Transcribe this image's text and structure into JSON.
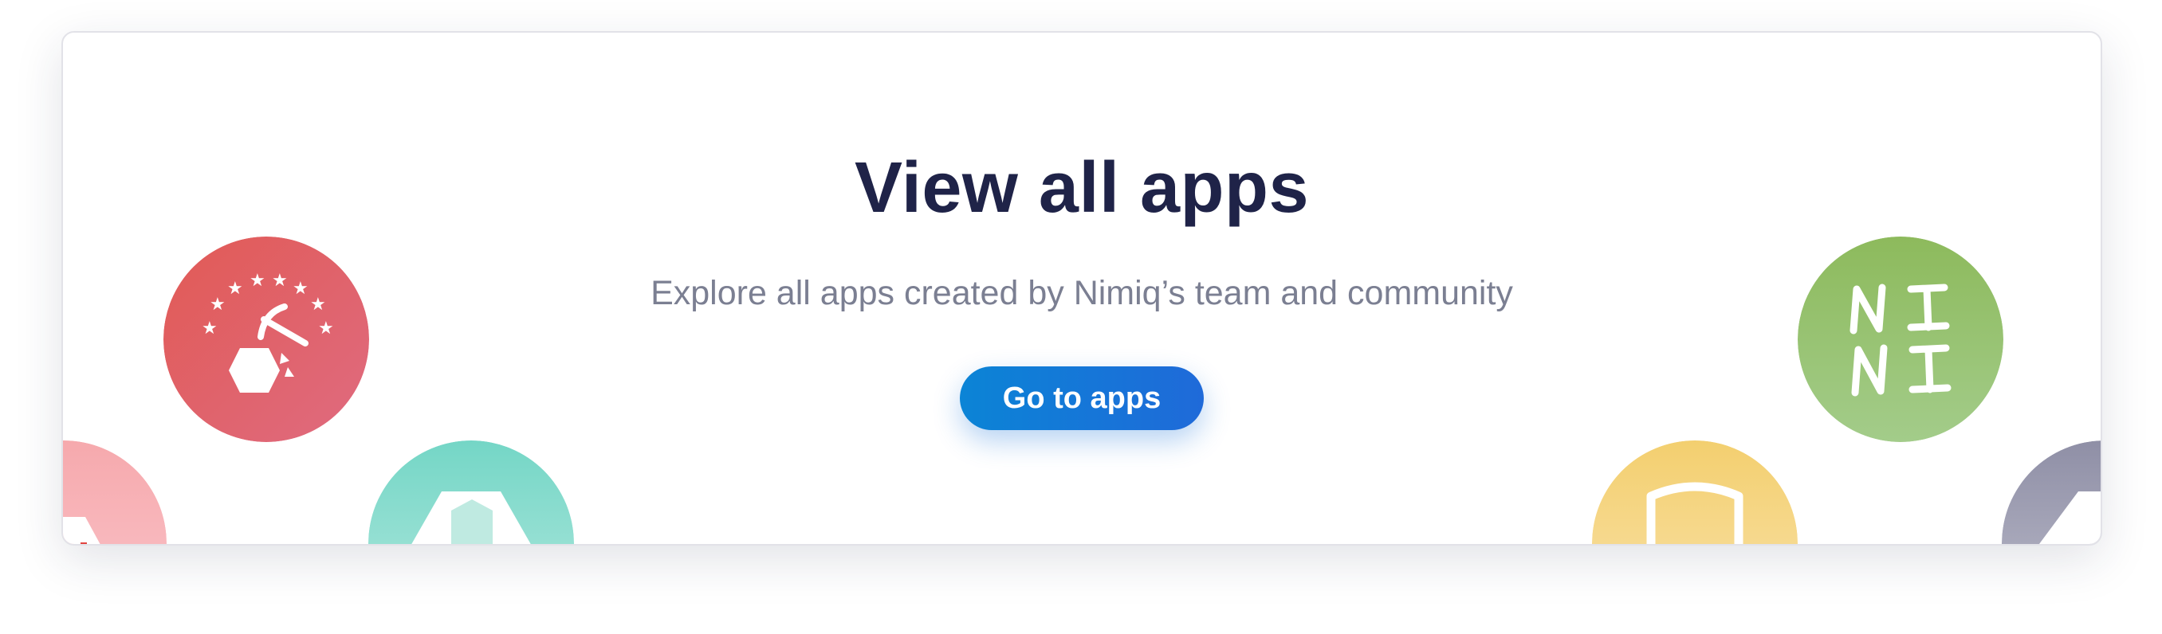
{
  "hero": {
    "title": "View all apps",
    "subtitle": "Explore all apps created by Nimiq’s team and community",
    "cta_label": "Go to apps"
  },
  "app_icons": [
    {
      "name": "pickaxe-miner-icon",
      "color": "#e3626a"
    },
    {
      "name": "ni-ni-game-icon",
      "color": "#96bd6a"
    },
    {
      "name": "pink-hexagon-icon",
      "color": "#f7a9b0"
    },
    {
      "name": "teal-hexagon-icon",
      "color": "#7fd6c6"
    },
    {
      "name": "shield-icon",
      "color": "#f3d17b"
    },
    {
      "name": "gray-app-icon",
      "color": "#9a9aae"
    }
  ],
  "colors": {
    "title": "#1f2348",
    "subtitle": "#7b7f92",
    "button": "#0b84d6"
  }
}
